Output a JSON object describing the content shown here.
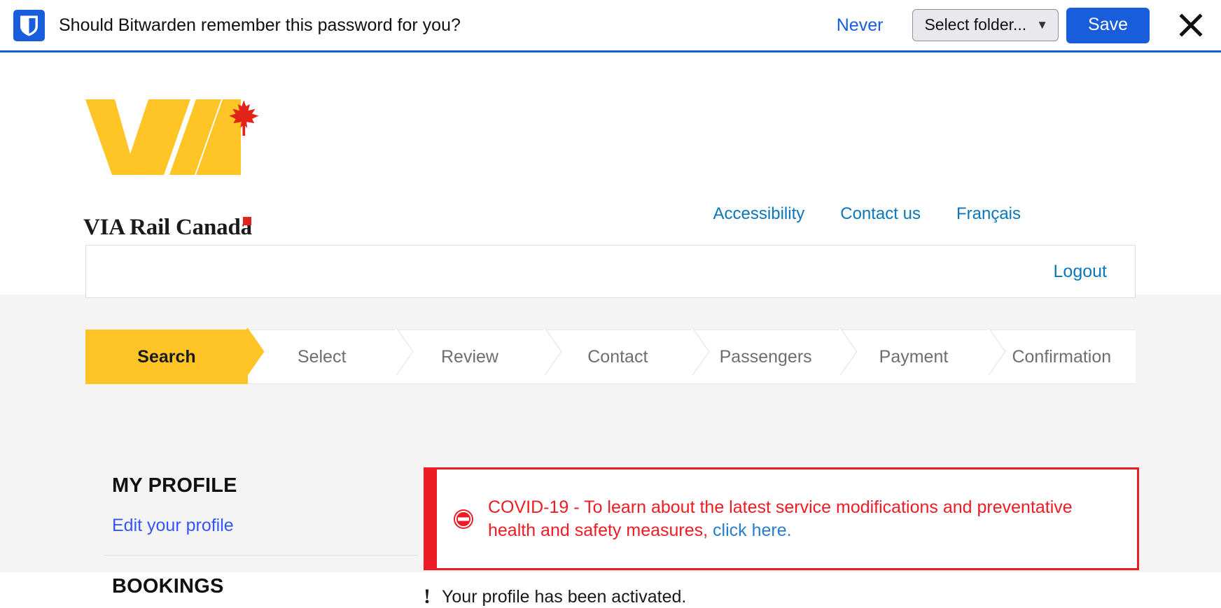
{
  "bitwarden_bar": {
    "logo_icon": "bitwarden-shield-icon",
    "question": "Should Bitwarden remember this password for you?",
    "never_label": "Never",
    "folder_select_value": "Select folder...",
    "folder_chevron_icon": "chevron-down-icon",
    "save_label": "Save",
    "close_icon": "close-icon",
    "accent_color": "#175ddc"
  },
  "site_header": {
    "logo_name": "via-rail-canada-logo",
    "wordmark": "VIA Rail Canada",
    "nav_links": [
      {
        "label": "Accessibility"
      },
      {
        "label": "Contact us"
      },
      {
        "label": "Français"
      }
    ],
    "link_color": "#0b76ba"
  },
  "account_bar": {
    "logout_label": "Logout"
  },
  "booking_steps": {
    "items": [
      {
        "label": "Search",
        "active": true
      },
      {
        "label": "Select",
        "active": false
      },
      {
        "label": "Review",
        "active": false
      },
      {
        "label": "Contact",
        "active": false
      },
      {
        "label": "Passengers",
        "active": false
      },
      {
        "label": "Payment",
        "active": false
      },
      {
        "label": "Confirmation",
        "active": false
      }
    ],
    "active_color": "#ffc425"
  },
  "sidebar": {
    "profile_heading": "MY PROFILE",
    "profile_link": "Edit your profile",
    "bookings_heading": "BOOKINGS"
  },
  "covid_alert": {
    "icon": "no-entry-icon",
    "text_before": "COVID-19 - To learn about the latest service modifications and preventative health and safety measures, ",
    "link_label": "click here.",
    "border_color": "#ed1c24",
    "text_color": "#ee1c25",
    "link_color": "#2a7cc7"
  },
  "activated_notice": {
    "icon": "exclamation-icon",
    "icon_glyph": "!",
    "message": "Your profile has been activated."
  }
}
